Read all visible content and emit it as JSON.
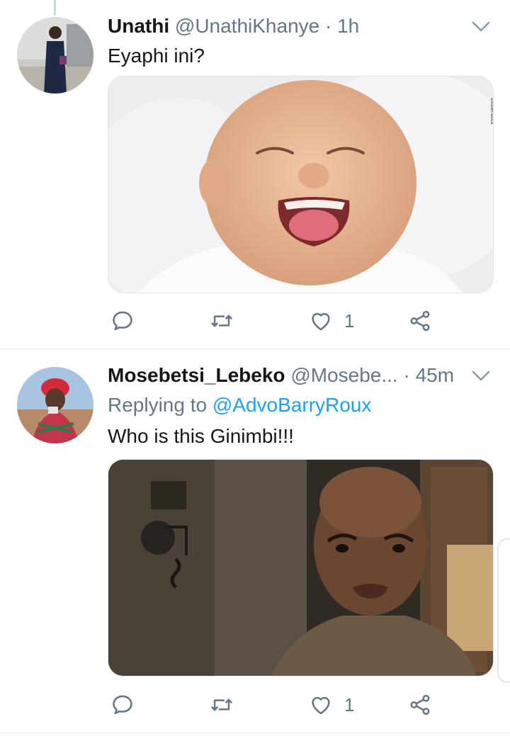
{
  "tweets": [
    {
      "name": "Unathi",
      "handle": "@UnathiKhanye",
      "separator": "·",
      "time": "1h",
      "text": "Eyaphi ini?",
      "media_label": "laughing-baby-photo",
      "watermark": "shutterstock",
      "reply_count": "",
      "retweet_count": "",
      "like_count": "1"
    },
    {
      "name": "Mosebetsi_Lebeko",
      "handle": "@Mosebe...",
      "separator": "·",
      "time": "45m",
      "replying_prefix": "Replying to",
      "replying_to": "@AdvoBarryRoux",
      "text": "Who is this Ginimbi!!!",
      "media_label": "confused-man-photo",
      "reply_count": "",
      "retweet_count": "",
      "like_count": "1"
    }
  ],
  "colors": {
    "text": "#14171a",
    "secondary": "#657786",
    "link": "#1da1f2",
    "divider": "#e1e8ed"
  }
}
